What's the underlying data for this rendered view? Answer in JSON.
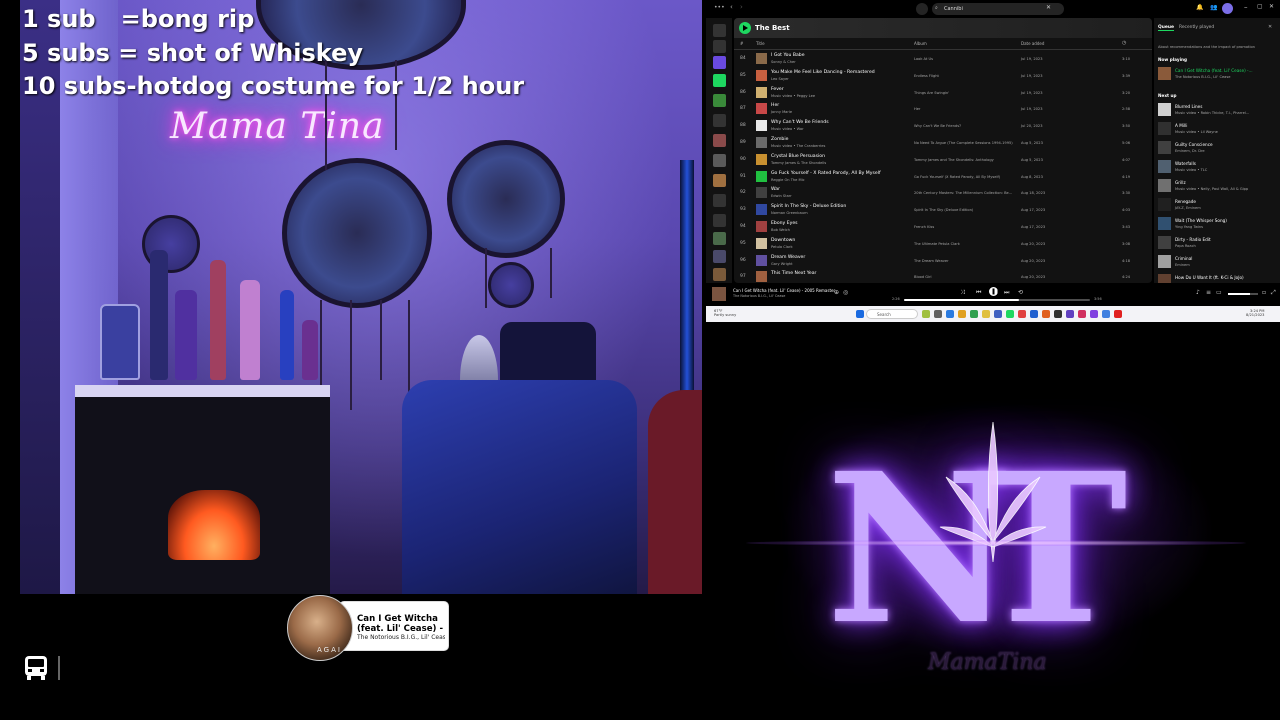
{
  "stream_overlay": {
    "lines": [
      "1 sub   =bong rip",
      "5 subs = shot of Whiskey",
      "10 subs-hotdog costume for 1/2 hour"
    ]
  },
  "webcam": {
    "neon_sign": "Mama Tina"
  },
  "now_playing_widget": {
    "title": "Can I Get Witcha (feat. Lil' Cease) - ...",
    "artist": "The Notorious B.I.G., Lil' Cease",
    "art_label": "AGAI"
  },
  "spotify": {
    "search_value": "Cannibi",
    "playlist_title": "The Best",
    "columns": {
      "number": "#",
      "title": "Title",
      "album": "Album",
      "date_added": "Date added",
      "duration_icon": "clock-icon"
    },
    "tracks": [
      {
        "n": "84",
        "title": "I Got You Babe",
        "artist": "Sonny & Cher",
        "album": "Look At Us",
        "date": "Jul 19, 2023",
        "dur": "3:10",
        "color": "#8a6a4a"
      },
      {
        "n": "85",
        "title": "You Make Me Feel Like Dancing - Remastered",
        "artist": "Leo Sayer",
        "album": "Endless Flight",
        "date": "Jul 19, 2023",
        "dur": "3:39",
        "color": "#c86040"
      },
      {
        "n": "86",
        "title": "Fever",
        "artist": "Music video • Peggy Lee",
        "album": "Things Are Swingin'",
        "date": "Jul 19, 2023",
        "dur": "3:20",
        "color": "#d0b070"
      },
      {
        "n": "87",
        "title": "Her",
        "artist": "Jonny Marie",
        "album": "Her",
        "date": "Jul 19, 2023",
        "dur": "2:58",
        "color": "#c84848"
      },
      {
        "n": "88",
        "title": "Why Can't We Be Friends",
        "artist": "Music video • War",
        "album": "Why Can't We Be Friends?",
        "date": "Jul 20, 2023",
        "dur": "3:50",
        "color": "#e8e8e8"
      },
      {
        "n": "89",
        "title": "Zombie",
        "artist": "Music video • The Cranberries",
        "album": "No Need To Argue (The Complete Sessions 1994-1995)",
        "date": "Aug 5, 2023",
        "dur": "5:06",
        "color": "#6a6a6a"
      },
      {
        "n": "90",
        "title": "Crystal Blue Persuasion",
        "artist": "Tommy James & The Shondells",
        "album": "Tommy James and The Shondells: Anthology",
        "date": "Aug 5, 2023",
        "dur": "4:07",
        "color": "#c89030"
      },
      {
        "n": "91",
        "title": "Go Fuck Yourself - X Rated Parody, All By Myself",
        "artist": "Reggie On The Mic",
        "album": "Go Fuck Yourself (X Rated Parody, All By Myself)",
        "date": "Aug 8, 2023",
        "dur": "4:19",
        "color": "#20c040"
      },
      {
        "n": "92",
        "title": "War",
        "artist": "Edwin Starr",
        "album": "20th Century Masters: The Millennium Collection: Be...",
        "date": "Aug 18, 2023",
        "dur": "3:30",
        "color": "#404040"
      },
      {
        "n": "93",
        "title": "Spirit In The Sky - Deluxe Edition",
        "artist": "Norman Greenbaum",
        "album": "Spirit In The Sky (Deluxe Edition)",
        "date": "Aug 17, 2023",
        "dur": "4:03",
        "color": "#3048a0"
      },
      {
        "n": "94",
        "title": "Ebony Eyes",
        "artist": "Bob Welch",
        "album": "French Kiss",
        "date": "Aug 17, 2023",
        "dur": "3:43",
        "color": "#a04040"
      },
      {
        "n": "95",
        "title": "Downtown",
        "artist": "Petula Clark",
        "album": "The Ultimate Petula Clark",
        "date": "Aug 20, 2023",
        "dur": "3:08",
        "color": "#d0c0a0"
      },
      {
        "n": "96",
        "title": "Dream Weaver",
        "artist": "Gary Wright",
        "album": "The Dream Weaver",
        "date": "Aug 20, 2023",
        "dur": "4:18",
        "color": "#6050a0"
      },
      {
        "n": "97",
        "title": "This Time Next Year",
        "artist": "",
        "album": "Blood Girl",
        "date": "Aug 20, 2023",
        "dur": "4:24",
        "color": "#a06040"
      }
    ],
    "queue": {
      "tabs": [
        "Queue",
        "Recently played"
      ],
      "notice": "About recommendations and the impact of promotion",
      "now_playing_label": "Now playing",
      "now_playing": {
        "title": "Can I Get Witcha (feat. Lil' Cease) -...",
        "artist": "The Notorious B.I.G., Lil' Cease",
        "color": "#8a5a3a"
      },
      "next_up_label": "Next up",
      "items": [
        {
          "title": "Blurred Lines",
          "artist": "Music video • Robin Thicke, T.I., Pharrel...",
          "color": "#d0d0d0"
        },
        {
          "title": "A Milli",
          "artist": "Music video • Lil Wayne",
          "color": "#303030"
        },
        {
          "title": "Guilty Conscience",
          "artist": "Eminem, Dr. Dre",
          "color": "#404040"
        },
        {
          "title": "Waterfalls",
          "artist": "Music video • TLC",
          "color": "#506070"
        },
        {
          "title": "Grillz",
          "artist": "Music video • Nelly, Paul Wall, Ali & Gipp",
          "color": "#707070"
        },
        {
          "title": "Renegade",
          "artist": "JAY-Z, Eminem",
          "color": "#202020"
        },
        {
          "title": "Wait (The Whisper Song)",
          "artist": "Ying Yang Twins",
          "color": "#305070"
        },
        {
          "title": "Dirty - Radio Edit",
          "artist": "Papa Roach",
          "color": "#404040"
        },
        {
          "title": "Criminal",
          "artist": "Eminem",
          "color": "#a0a0a0"
        },
        {
          "title": "How Do U Want It (ft. K-Ci & JoJo)",
          "artist": "",
          "color": "#604030"
        }
      ]
    },
    "player": {
      "title": "Can I Get Witcha (feat. Lil' Cease) - 2005 Remaster",
      "artist": "The Notorious B.I.G., Lil' Cease",
      "elapsed": "2:26",
      "total": "3:56",
      "progress": 0.62
    }
  },
  "taskbar": {
    "weather_temp": "67°F",
    "weather_desc": "Partly sunny",
    "search_placeholder": "Search",
    "time": "3:24 PM",
    "date": "8/21/2023"
  },
  "logo": {
    "letters": "NT",
    "script": "MamaTina"
  }
}
